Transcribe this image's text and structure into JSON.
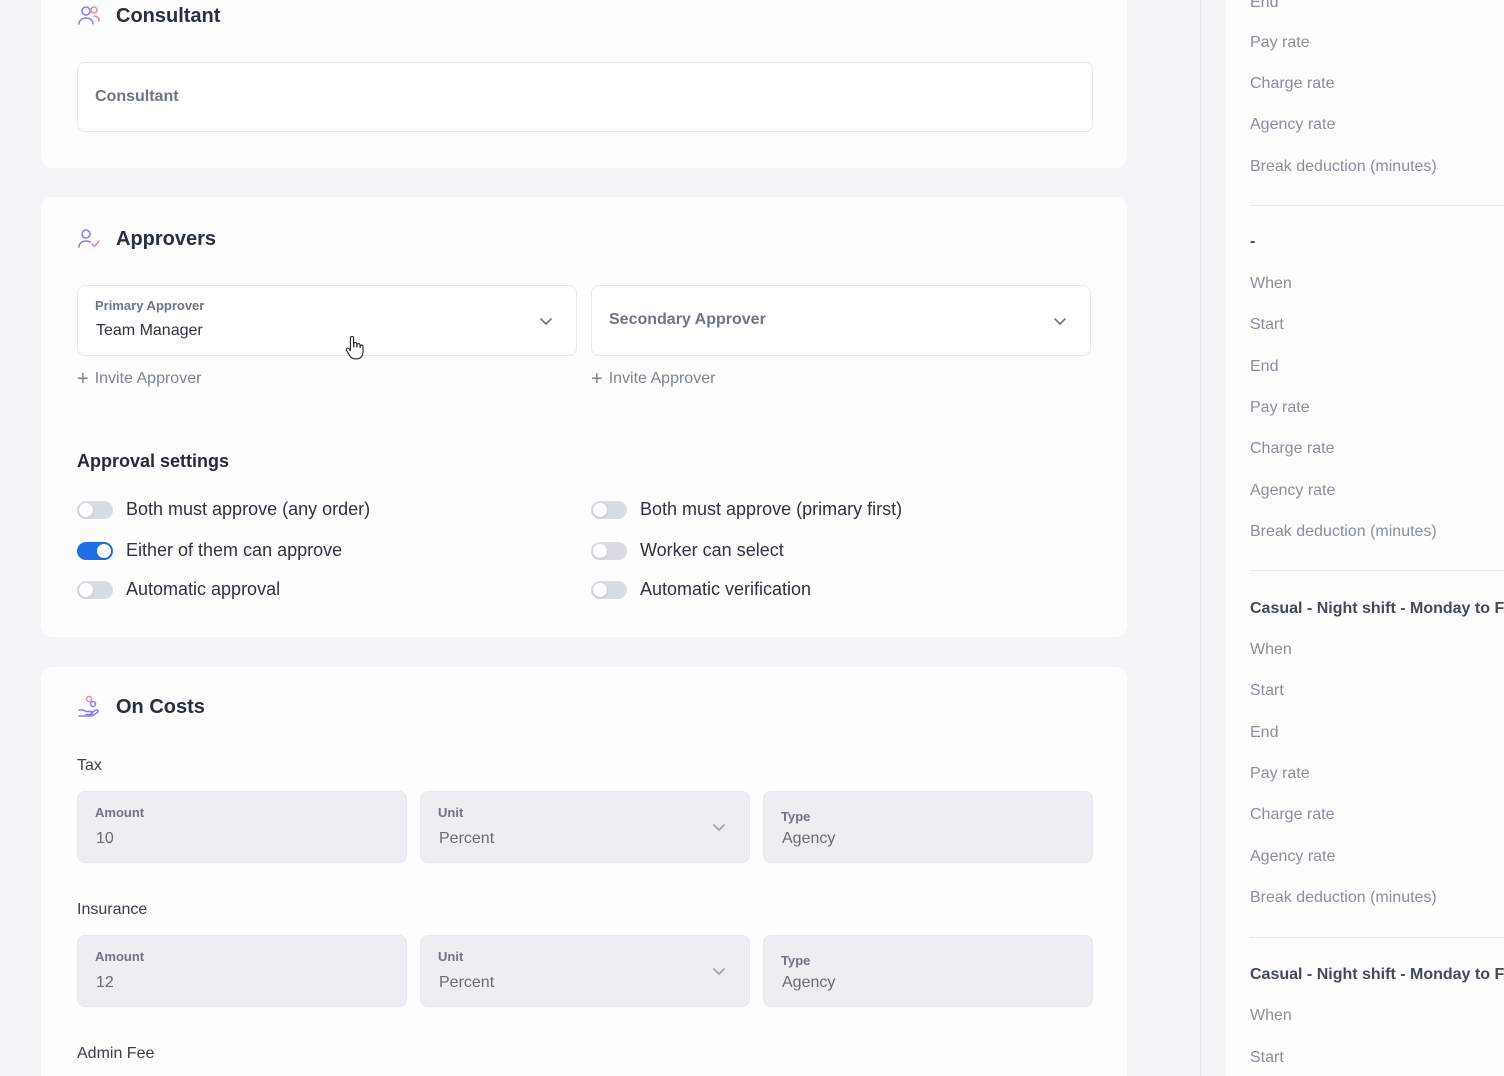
{
  "consultant": {
    "title": "Consultant",
    "field_value": "Consultant"
  },
  "approvers": {
    "title": "Approvers",
    "primary": {
      "label": "Primary Approver",
      "value": "Team Manager"
    },
    "secondary": {
      "label": "Secondary Approver"
    },
    "invite_label": "Invite Approver",
    "settings_title": "Approval settings",
    "settings": [
      {
        "label": "Both must approve (any order)",
        "on": false
      },
      {
        "label": "Both must approve (primary first)",
        "on": false
      },
      {
        "label": "Either of them can approve",
        "on": true
      },
      {
        "label": "Worker can select",
        "on": false
      },
      {
        "label": "Automatic approval",
        "on": false
      },
      {
        "label": "Automatic verification",
        "on": false
      }
    ]
  },
  "oncosts": {
    "title": "On Costs",
    "groups": [
      {
        "name": "Tax",
        "amount_label": "Amount",
        "amount": "10",
        "unit_label": "Unit",
        "unit": "Percent",
        "type_label": "Type",
        "type": "Agency"
      },
      {
        "name": "Insurance",
        "amount_label": "Amount",
        "amount": "12",
        "unit_label": "Unit",
        "unit": "Percent",
        "type_label": "Type",
        "type": "Agency"
      },
      {
        "name": "Admin Fee"
      }
    ]
  },
  "right_panel": {
    "block0": [
      "End",
      "Pay rate",
      "Charge rate",
      "Agency rate",
      "Break deduction (minutes)"
    ],
    "block1": {
      "title": "-",
      "items": [
        "When",
        "Start",
        "End",
        "Pay rate",
        "Charge rate",
        "Agency rate",
        "Break deduction (minutes)"
      ]
    },
    "block2": {
      "title": "Casual - Night shift - Monday to F",
      "items": [
        "When",
        "Start",
        "End",
        "Pay rate",
        "Charge rate",
        "Agency rate",
        "Break deduction (minutes)"
      ]
    },
    "block3": {
      "title": "Casual - Night shift - Monday to F",
      "items": [
        "When",
        "Start"
      ]
    }
  },
  "colors": {
    "accent": "#1f6fe6",
    "icon_purple": "#8b7cf6",
    "icon_pink": "#f08ab0"
  }
}
